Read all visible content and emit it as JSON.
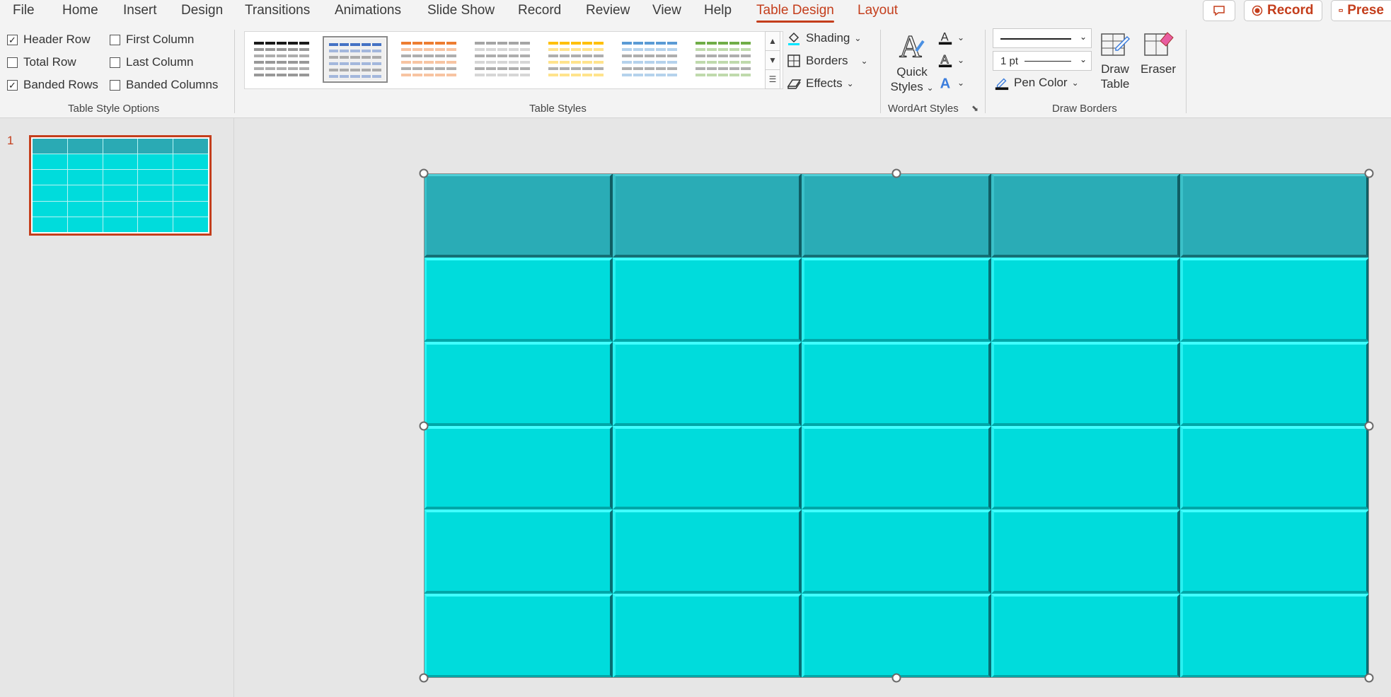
{
  "menubar": {
    "items": [
      "File",
      "Home",
      "Insert",
      "Design",
      "Transitions",
      "Animations",
      "Slide Show",
      "Record",
      "Review",
      "View",
      "Help",
      "Table Design",
      "Layout"
    ],
    "active": "Table Design",
    "record_button": "Record",
    "present_button": "Prese"
  },
  "ribbon": {
    "table_style_options": {
      "label": "Table Style Options",
      "options": [
        {
          "label": "Header Row",
          "checked": true
        },
        {
          "label": "First Column",
          "checked": false
        },
        {
          "label": "Total Row",
          "checked": false
        },
        {
          "label": "Last Column",
          "checked": false
        },
        {
          "label": "Banded Rows",
          "checked": true
        },
        {
          "label": "Banded Columns",
          "checked": false
        }
      ]
    },
    "table_styles": {
      "label": "Table Styles",
      "thumbnail_colors": [
        "#1a1a1a",
        "#4472c4",
        "#ed7d31",
        "#a5a5a5",
        "#ffc000",
        "#5b9bd5",
        "#70ad47"
      ],
      "selected_index": 1,
      "shading": "Shading",
      "borders": "Borders",
      "effects": "Effects"
    },
    "wordart_styles": {
      "label": "WordArt Styles",
      "quick_styles_line1": "Quick",
      "quick_styles_line2": "Styles"
    },
    "draw_borders": {
      "label": "Draw Borders",
      "pen_weight": "1 pt",
      "pen_color": "Pen Color",
      "draw_table_line1": "Draw",
      "draw_table_line2": "Table",
      "eraser": "Eraser"
    }
  },
  "slides": {
    "current_number": "1"
  },
  "table": {
    "rows": 6,
    "columns": 5,
    "header_color": "#2aacb6",
    "body_color": "#00dcdc"
  },
  "colors": {
    "accent": "#c43e1c"
  }
}
